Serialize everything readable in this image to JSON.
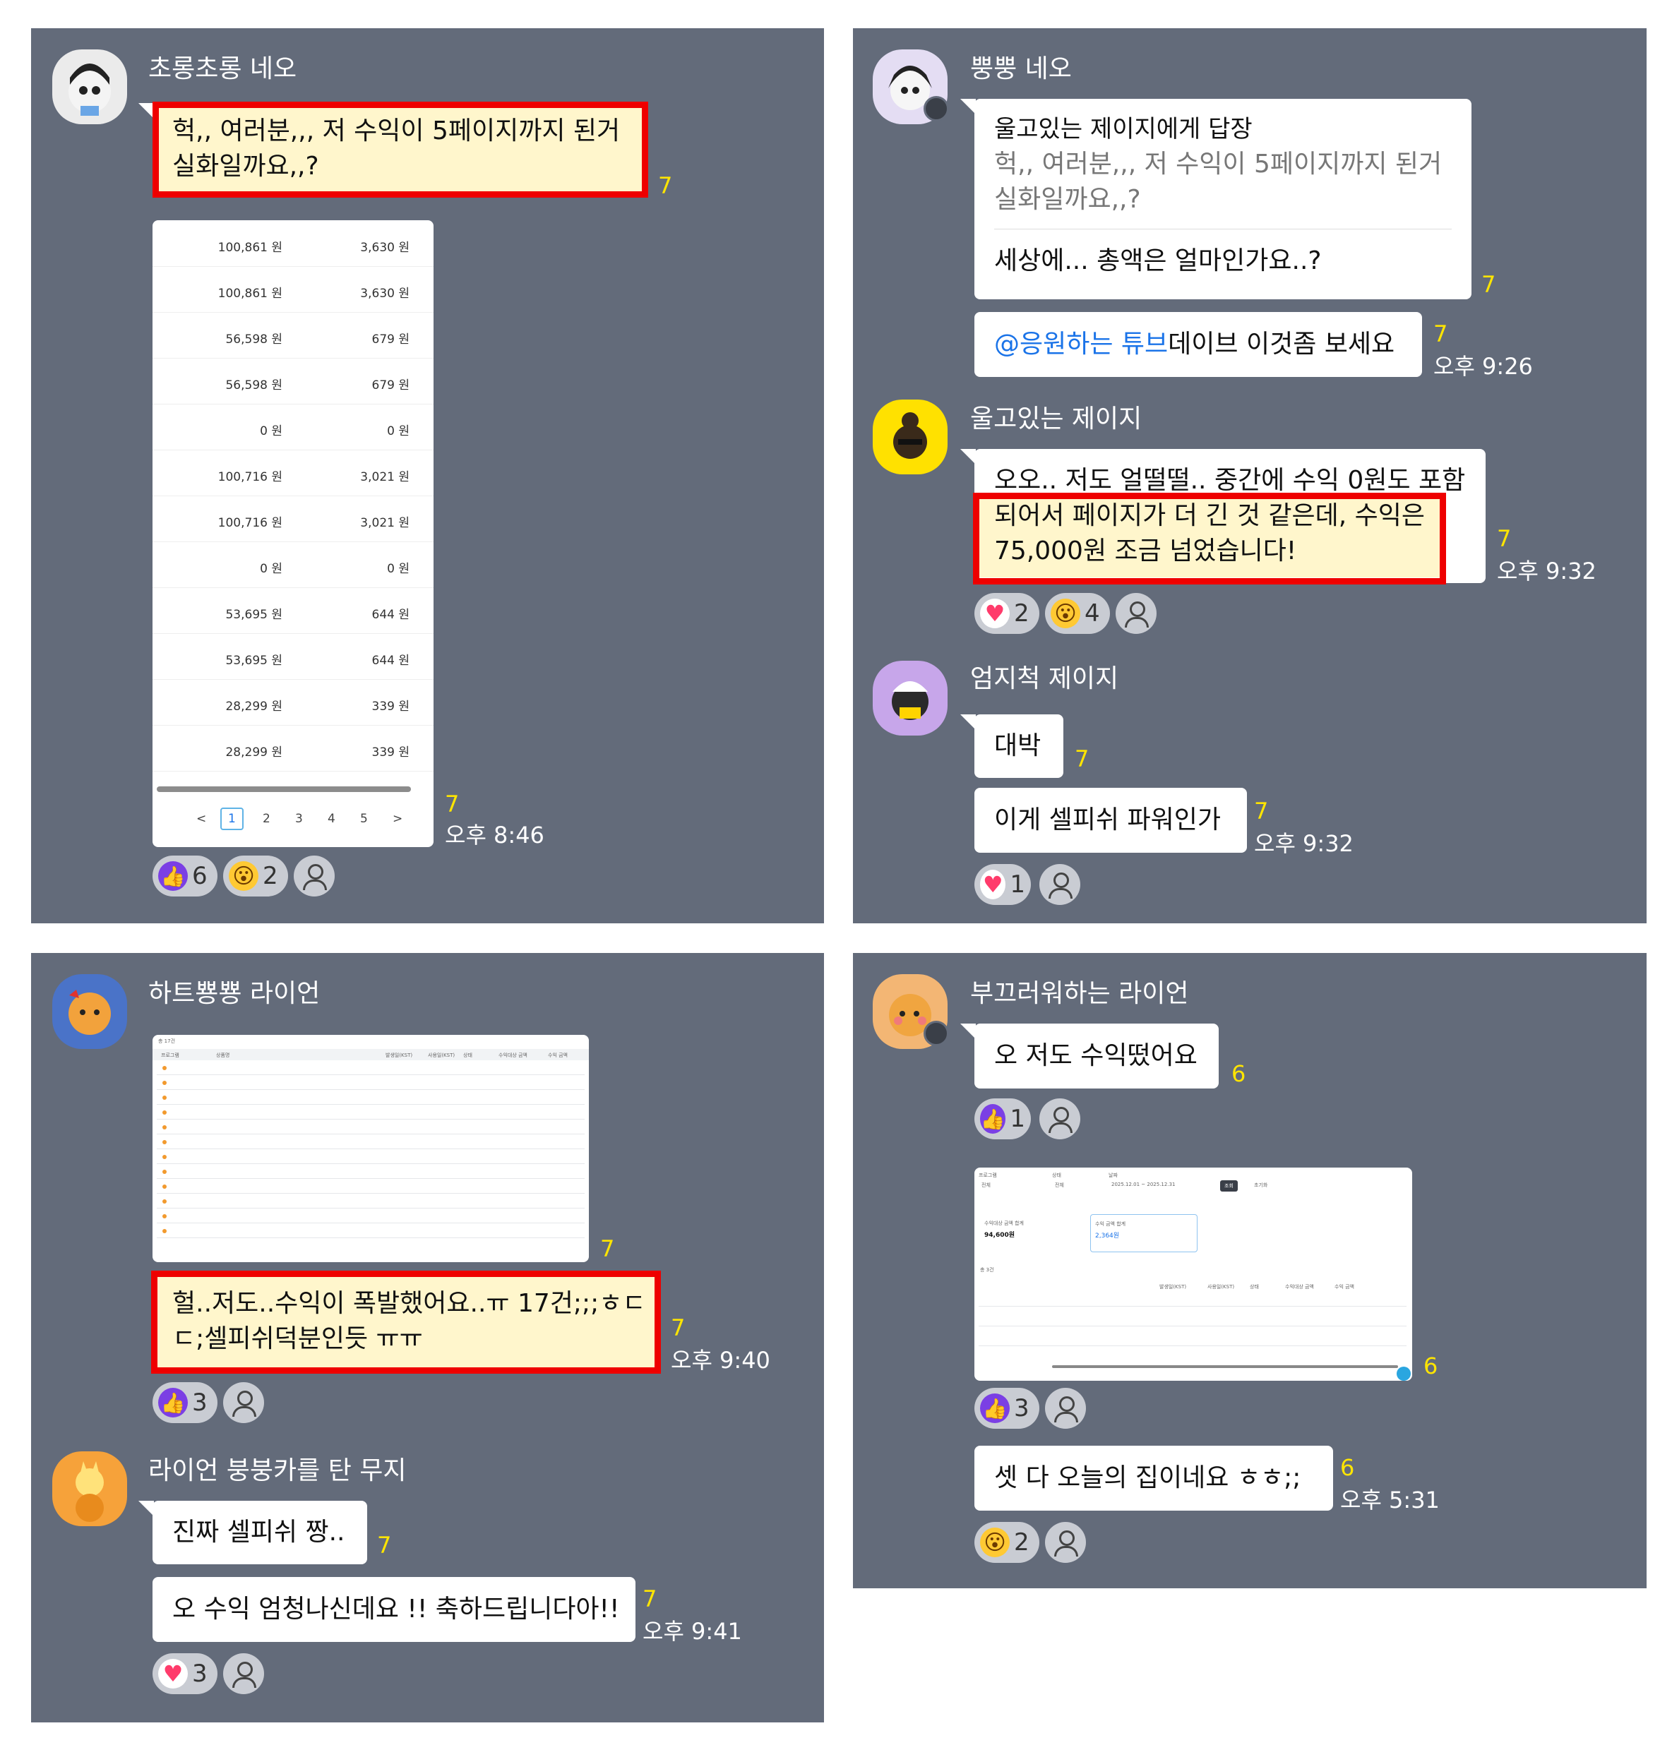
{
  "panels": {
    "p1": {
      "sender": "초롱초롱 네오",
      "msg1_line1": "헉,, 여러분,,, 저 수익이 5페이지까지 된거",
      "msg1_line2": "실화일까요,,?",
      "msg1_unread": "7",
      "table_rows": [
        {
          "a": "100,861 원",
          "b": "3,630 원"
        },
        {
          "a": "100,861 원",
          "b": "3,630 원"
        },
        {
          "a": "56,598 원",
          "b": "679 원"
        },
        {
          "a": "56,598 원",
          "b": "679 원"
        },
        {
          "a": "0 원",
          "b": "0 원"
        },
        {
          "a": "100,716 원",
          "b": "3,021 원"
        },
        {
          "a": "100,716 원",
          "b": "3,021 원"
        },
        {
          "a": "0 원",
          "b": "0 원"
        },
        {
          "a": "53,695 원",
          "b": "644 원"
        },
        {
          "a": "53,695 원",
          "b": "644 원"
        },
        {
          "a": "28,299 원",
          "b": "339 원"
        },
        {
          "a": "28,299 원",
          "b": "339 원"
        }
      ],
      "pager": [
        "<",
        "1",
        "2",
        "3",
        "4",
        "5",
        ">"
      ],
      "img_unread": "7",
      "img_time": "오후 8:46",
      "react_like": "6",
      "react_wow": "2"
    },
    "p2": {
      "sender1": "뿡뿡 네오",
      "reply_header": "울고있는 제이지에게 답장",
      "reply_quote1": "헉,, 여러분,,, 저 수익이 5페이지까지 된거",
      "reply_quote2": "실화일까요,,?",
      "reply_text": "세상에... 총액은 얼마인가요..?",
      "reply_unread": "7",
      "mention": "@응원하는 튜브",
      "mention_text": " 데이브 이것좀 보세요",
      "mention_unread": "7",
      "mention_time": "오후 9:26",
      "sender2": "울고있는 제이지",
      "msg2_line1": "오오.. 저도 얼떨떨.. 중간에 수익 0원도 포함",
      "msg2_line2": "되어서 페이지가 더 긴 것 같은데, 수익은",
      "msg2_line3": "75,000원 조금 넘었습니다!",
      "msg2_unread": "7",
      "msg2_time": "오후 9:32",
      "react_heart": "2",
      "react_wow": "4",
      "sender3": "엄지척 제이지",
      "msg3": "대박",
      "msg3_unread": "7",
      "msg4": "이게 셀피쉬 파워인가",
      "msg4_unread": "7",
      "msg4_time": "오후 9:32",
      "react2_heart": "1"
    },
    "p3": {
      "sender1": "하트뿅뿅 라이언",
      "img_unread": "7",
      "msg1_line1": "헐..저도..수익이 폭발했어요..ㅠ 17건;;;ㅎㄷ",
      "msg1_line2": "ㄷ;셀피쉬덕분인듯 ㅠㅠ",
      "msg1_unread": "7",
      "msg1_time": "오후 9:40",
      "react_like": "3",
      "sender2": "라이언 붕붕카를 탄 무지",
      "msg2": "진짜 셀피쉬 짱..",
      "msg2_unread": "7",
      "msg3": "오 수익 엄청나신데요 !! 축하드립니다아!!",
      "msg3_unread": "7",
      "msg3_time": "오후 9:41",
      "react_heart": "3"
    },
    "p4": {
      "sender": "부끄러워하는 라이언",
      "msg1": "오 저도 수익떴어요",
      "msg1_unread": "6",
      "react1_like": "1",
      "img_unread": "6",
      "react2_like": "3",
      "msg2": "셋 다 오늘의 집이네요 ㅎㅎ;;",
      "msg2_unread": "6",
      "msg2_time": "오후 5:31",
      "react3_wow": "2"
    }
  },
  "mini_screens": {
    "s3": {
      "title": "총 17건",
      "headers": [
        "프로그램",
        "상품명",
        "발생일(KST)",
        "사용일(KST)",
        "상태",
        "수익대상 금액",
        "수익 금액"
      ]
    },
    "s4": {
      "filter_labels": [
        "프로그램",
        "상태",
        "날짜"
      ],
      "filter_values": [
        "전체",
        "전체",
        "2025.12.01 ~ 2025.12.31"
      ],
      "search": "조회",
      "reset": "초기화",
      "stat1_label": "수익대상 금액 합계",
      "stat1_value": "94,600원",
      "stat2_label": "수익 금액 합계",
      "stat2_value": "2,364원",
      "count": "총 3건",
      "headers": [
        "발생일(KST)",
        "사용일(KST)",
        "상태",
        "수익대상 금액",
        "수익 금액"
      ]
    }
  },
  "colors": {
    "panel": "#636b7a",
    "unread": "#ffe500",
    "highlight": "#ee0000",
    "mention": "#1a73e8"
  }
}
